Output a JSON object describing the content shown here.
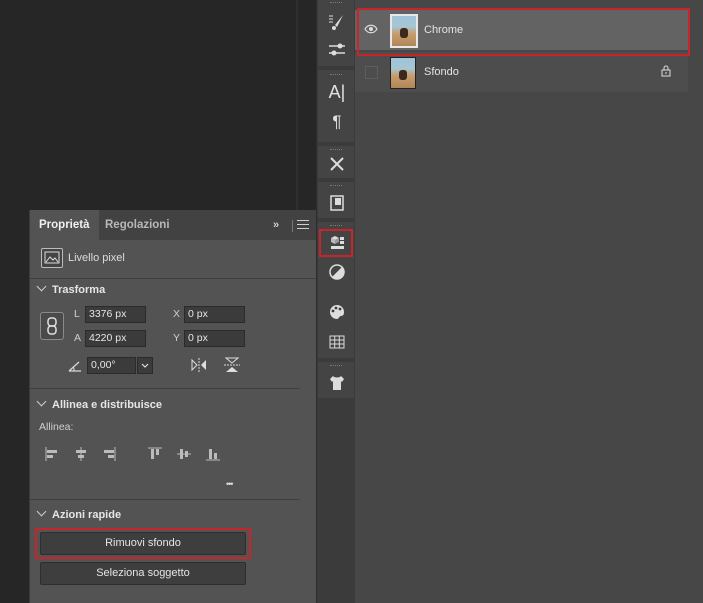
{
  "properties_panel": {
    "tabs": [
      "Proprietà",
      "Regolazioni"
    ],
    "collapse_glyph": "»",
    "layer_kind": "Livello pixel",
    "transform": {
      "title": "Trasforma",
      "width_label": "L",
      "width_value": "3376 px",
      "height_label": "A",
      "height_value": "4220 px",
      "x_label": "X",
      "x_value": "0 px",
      "y_label": "Y",
      "y_value": "0 px",
      "angle_value": "0,00°"
    },
    "align": {
      "title": "Allinea e distribuisce",
      "label": "Allinea:",
      "more_glyph": "•••"
    },
    "quick_actions": {
      "title": "Azioni rapide",
      "remove_bg": "Rimuovi sfondo",
      "select_subject": "Seleziona soggetto"
    }
  },
  "layers": [
    {
      "name": "Chrome",
      "visible": true,
      "selected": true,
      "locked": false
    },
    {
      "name": "Sfondo",
      "visible": false,
      "selected": false,
      "locked": true
    }
  ],
  "colors": {
    "highlight": "#c8252a",
    "panel": "#535353",
    "strip": "#3b3b3b"
  },
  "icons": [
    "brush-settings-icon",
    "character-icon",
    "paragraph-icon",
    "tools-icon",
    "properties-icon",
    "cube-properties-icon",
    "adjustments-icon",
    "swatches-icon",
    "grid-icon",
    "tshirt-icon"
  ]
}
